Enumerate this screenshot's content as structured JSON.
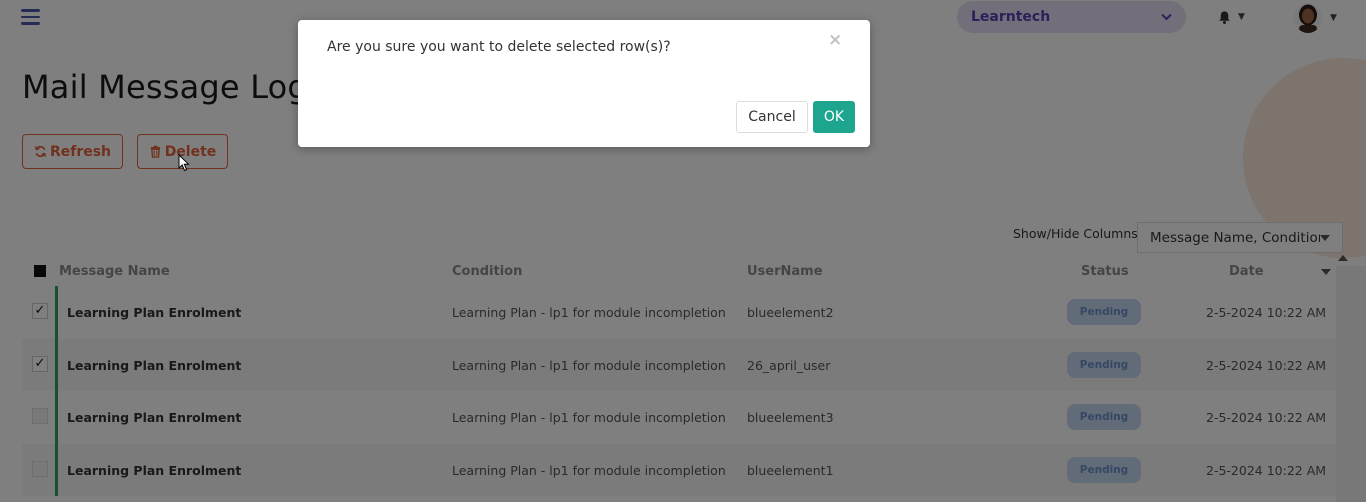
{
  "header": {
    "org_selector": "Learntech"
  },
  "page": {
    "title": "Mail Message Logs"
  },
  "toolbar": {
    "refresh_label": "Refresh",
    "delete_label": "Delete"
  },
  "columns_control": {
    "label": "Show/Hide Columns:",
    "value": "Message Name, Condition,"
  },
  "table": {
    "headers": [
      "Message Name",
      "Condition",
      "UserName",
      "Status",
      "Date"
    ],
    "rows": [
      {
        "checked": true,
        "name": "Learning Plan Enrolment",
        "condition": "Learning Plan - lp1 for module incompletion",
        "user": "blueelement2",
        "status": "Pending",
        "date": "2-5-2024 10:22 AM"
      },
      {
        "checked": true,
        "name": "Learning Plan Enrolment",
        "condition": "Learning Plan - lp1 for module incompletion",
        "user": "26_april_user",
        "status": "Pending",
        "date": "2-5-2024 10:22 AM"
      },
      {
        "checked": false,
        "name": "Learning Plan Enrolment",
        "condition": "Learning Plan - lp1 for module incompletion",
        "user": "blueelement3",
        "status": "Pending",
        "date": "2-5-2024 10:22 AM"
      },
      {
        "checked": false,
        "name": "Learning Plan Enrolment",
        "condition": "Learning Plan - lp1 for module incompletion",
        "user": "blueelement1",
        "status": "Pending",
        "date": "2-5-2024 10:22 AM"
      }
    ]
  },
  "modal": {
    "message": "Are you sure you want to delete selected row(s)?",
    "close_glyph": "×",
    "cancel_label": "Cancel",
    "ok_label": "OK"
  },
  "colors": {
    "accent_orange": "#e0633a",
    "ok_green": "#1da58f",
    "row_bar_green": "#2fa350",
    "badge_blue": "#c5d8f1",
    "org_purple": "#5a3fb3"
  },
  "icons": {
    "menu": "hamburger-icon",
    "bell": "bell-icon",
    "refresh": "refresh-icon",
    "delete": "trash-icon",
    "close": "close-icon"
  }
}
